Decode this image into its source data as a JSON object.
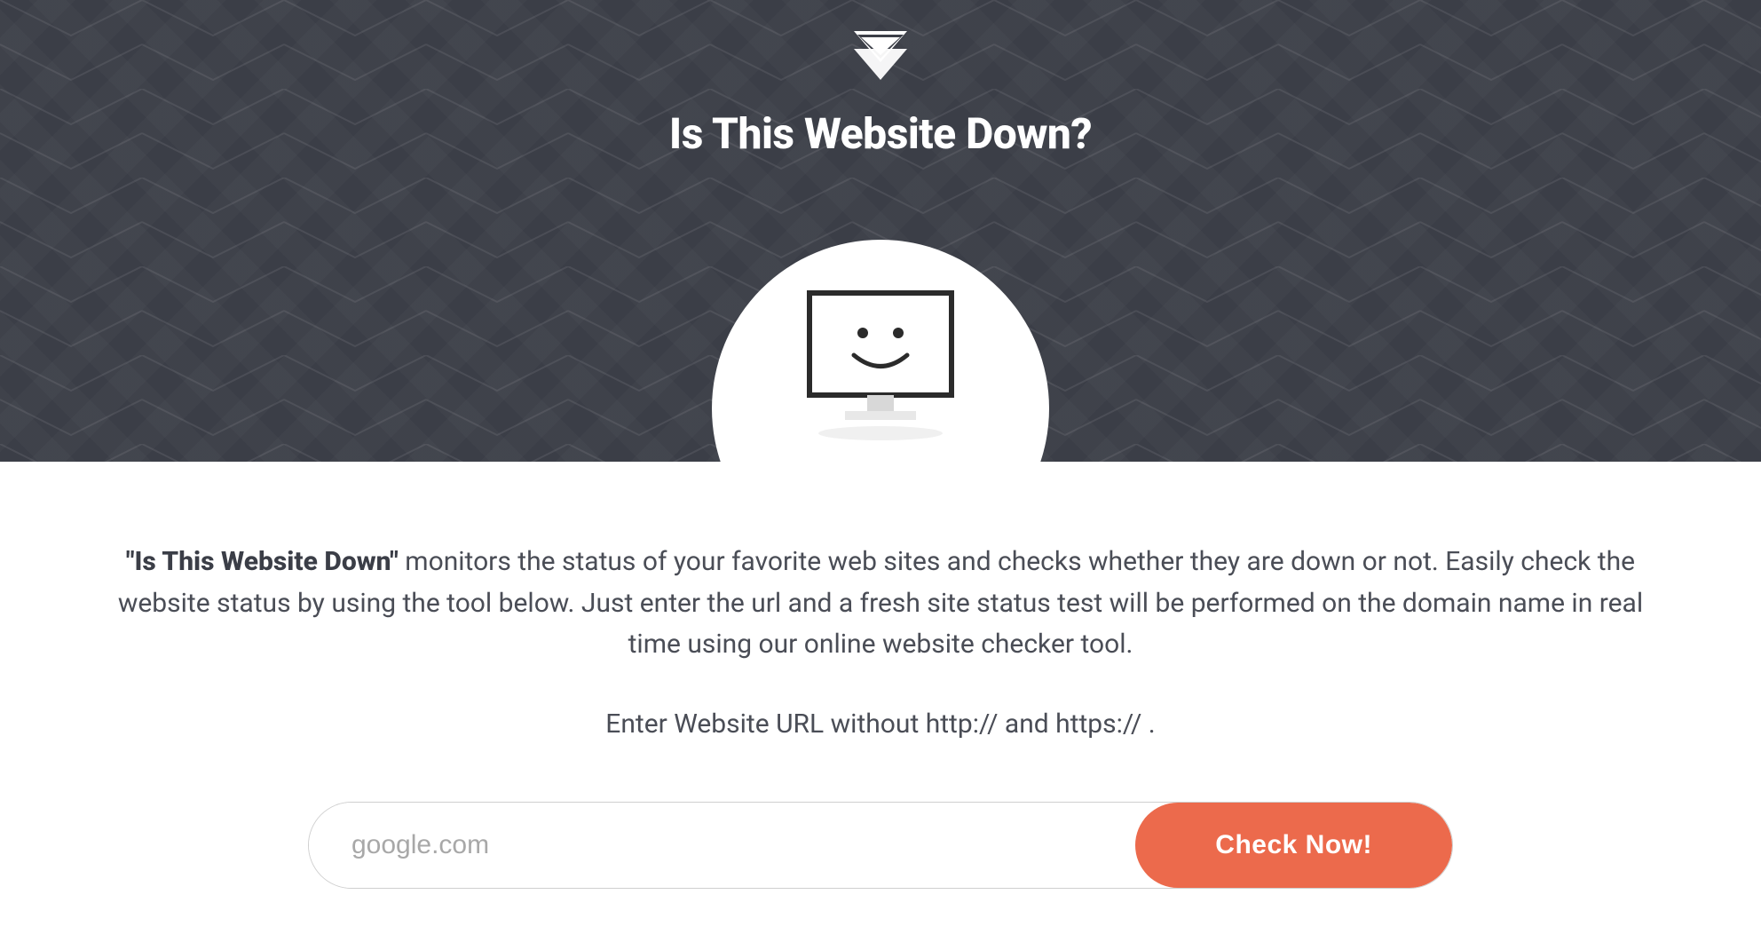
{
  "hero": {
    "title": "Is This Website Down?",
    "logo_icon": "chevron-down-triangle"
  },
  "content": {
    "description_bold": "\"Is This Website Down\"",
    "description_rest": " monitors the status of your favorite web sites and checks whether they are down or not. Easily check the website status by using the tool below. Just enter the url and a fresh site status test will be performed on the domain name in real time using our online website checker tool.",
    "instruction": "Enter Website URL without http:// and https:// ."
  },
  "form": {
    "url_placeholder": "google.com",
    "url_value": "",
    "check_button_label": "Check Now!"
  },
  "colors": {
    "hero_bg": "#3b3e47",
    "accent": "#ec6a4c",
    "text": "#4a4d56"
  }
}
